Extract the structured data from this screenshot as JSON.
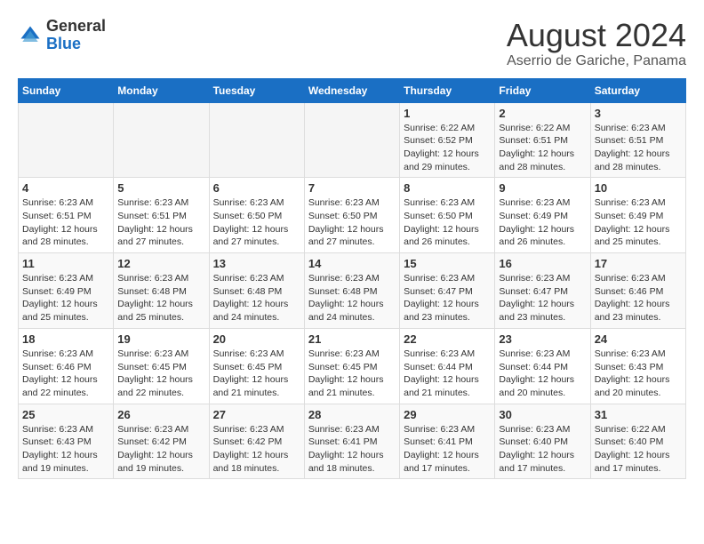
{
  "header": {
    "logo_general": "General",
    "logo_blue": "Blue",
    "month_title": "August 2024",
    "subtitle": "Aserrio de Gariche, Panama"
  },
  "weekdays": [
    "Sunday",
    "Monday",
    "Tuesday",
    "Wednesday",
    "Thursday",
    "Friday",
    "Saturday"
  ],
  "weeks": [
    [
      {
        "day": "",
        "detail": ""
      },
      {
        "day": "",
        "detail": ""
      },
      {
        "day": "",
        "detail": ""
      },
      {
        "day": "",
        "detail": ""
      },
      {
        "day": "1",
        "detail": "Sunrise: 6:22 AM\nSunset: 6:52 PM\nDaylight: 12 hours\nand 29 minutes."
      },
      {
        "day": "2",
        "detail": "Sunrise: 6:22 AM\nSunset: 6:51 PM\nDaylight: 12 hours\nand 28 minutes."
      },
      {
        "day": "3",
        "detail": "Sunrise: 6:23 AM\nSunset: 6:51 PM\nDaylight: 12 hours\nand 28 minutes."
      }
    ],
    [
      {
        "day": "4",
        "detail": "Sunrise: 6:23 AM\nSunset: 6:51 PM\nDaylight: 12 hours\nand 28 minutes."
      },
      {
        "day": "5",
        "detail": "Sunrise: 6:23 AM\nSunset: 6:51 PM\nDaylight: 12 hours\nand 27 minutes."
      },
      {
        "day": "6",
        "detail": "Sunrise: 6:23 AM\nSunset: 6:50 PM\nDaylight: 12 hours\nand 27 minutes."
      },
      {
        "day": "7",
        "detail": "Sunrise: 6:23 AM\nSunset: 6:50 PM\nDaylight: 12 hours\nand 27 minutes."
      },
      {
        "day": "8",
        "detail": "Sunrise: 6:23 AM\nSunset: 6:50 PM\nDaylight: 12 hours\nand 26 minutes."
      },
      {
        "day": "9",
        "detail": "Sunrise: 6:23 AM\nSunset: 6:49 PM\nDaylight: 12 hours\nand 26 minutes."
      },
      {
        "day": "10",
        "detail": "Sunrise: 6:23 AM\nSunset: 6:49 PM\nDaylight: 12 hours\nand 25 minutes."
      }
    ],
    [
      {
        "day": "11",
        "detail": "Sunrise: 6:23 AM\nSunset: 6:49 PM\nDaylight: 12 hours\nand 25 minutes."
      },
      {
        "day": "12",
        "detail": "Sunrise: 6:23 AM\nSunset: 6:48 PM\nDaylight: 12 hours\nand 25 minutes."
      },
      {
        "day": "13",
        "detail": "Sunrise: 6:23 AM\nSunset: 6:48 PM\nDaylight: 12 hours\nand 24 minutes."
      },
      {
        "day": "14",
        "detail": "Sunrise: 6:23 AM\nSunset: 6:48 PM\nDaylight: 12 hours\nand 24 minutes."
      },
      {
        "day": "15",
        "detail": "Sunrise: 6:23 AM\nSunset: 6:47 PM\nDaylight: 12 hours\nand 23 minutes."
      },
      {
        "day": "16",
        "detail": "Sunrise: 6:23 AM\nSunset: 6:47 PM\nDaylight: 12 hours\nand 23 minutes."
      },
      {
        "day": "17",
        "detail": "Sunrise: 6:23 AM\nSunset: 6:46 PM\nDaylight: 12 hours\nand 23 minutes."
      }
    ],
    [
      {
        "day": "18",
        "detail": "Sunrise: 6:23 AM\nSunset: 6:46 PM\nDaylight: 12 hours\nand 22 minutes."
      },
      {
        "day": "19",
        "detail": "Sunrise: 6:23 AM\nSunset: 6:45 PM\nDaylight: 12 hours\nand 22 minutes."
      },
      {
        "day": "20",
        "detail": "Sunrise: 6:23 AM\nSunset: 6:45 PM\nDaylight: 12 hours\nand 21 minutes."
      },
      {
        "day": "21",
        "detail": "Sunrise: 6:23 AM\nSunset: 6:45 PM\nDaylight: 12 hours\nand 21 minutes."
      },
      {
        "day": "22",
        "detail": "Sunrise: 6:23 AM\nSunset: 6:44 PM\nDaylight: 12 hours\nand 21 minutes."
      },
      {
        "day": "23",
        "detail": "Sunrise: 6:23 AM\nSunset: 6:44 PM\nDaylight: 12 hours\nand 20 minutes."
      },
      {
        "day": "24",
        "detail": "Sunrise: 6:23 AM\nSunset: 6:43 PM\nDaylight: 12 hours\nand 20 minutes."
      }
    ],
    [
      {
        "day": "25",
        "detail": "Sunrise: 6:23 AM\nSunset: 6:43 PM\nDaylight: 12 hours\nand 19 minutes."
      },
      {
        "day": "26",
        "detail": "Sunrise: 6:23 AM\nSunset: 6:42 PM\nDaylight: 12 hours\nand 19 minutes."
      },
      {
        "day": "27",
        "detail": "Sunrise: 6:23 AM\nSunset: 6:42 PM\nDaylight: 12 hours\nand 18 minutes."
      },
      {
        "day": "28",
        "detail": "Sunrise: 6:23 AM\nSunset: 6:41 PM\nDaylight: 12 hours\nand 18 minutes."
      },
      {
        "day": "29",
        "detail": "Sunrise: 6:23 AM\nSunset: 6:41 PM\nDaylight: 12 hours\nand 17 minutes."
      },
      {
        "day": "30",
        "detail": "Sunrise: 6:23 AM\nSunset: 6:40 PM\nDaylight: 12 hours\nand 17 minutes."
      },
      {
        "day": "31",
        "detail": "Sunrise: 6:22 AM\nSunset: 6:40 PM\nDaylight: 12 hours\nand 17 minutes."
      }
    ]
  ]
}
